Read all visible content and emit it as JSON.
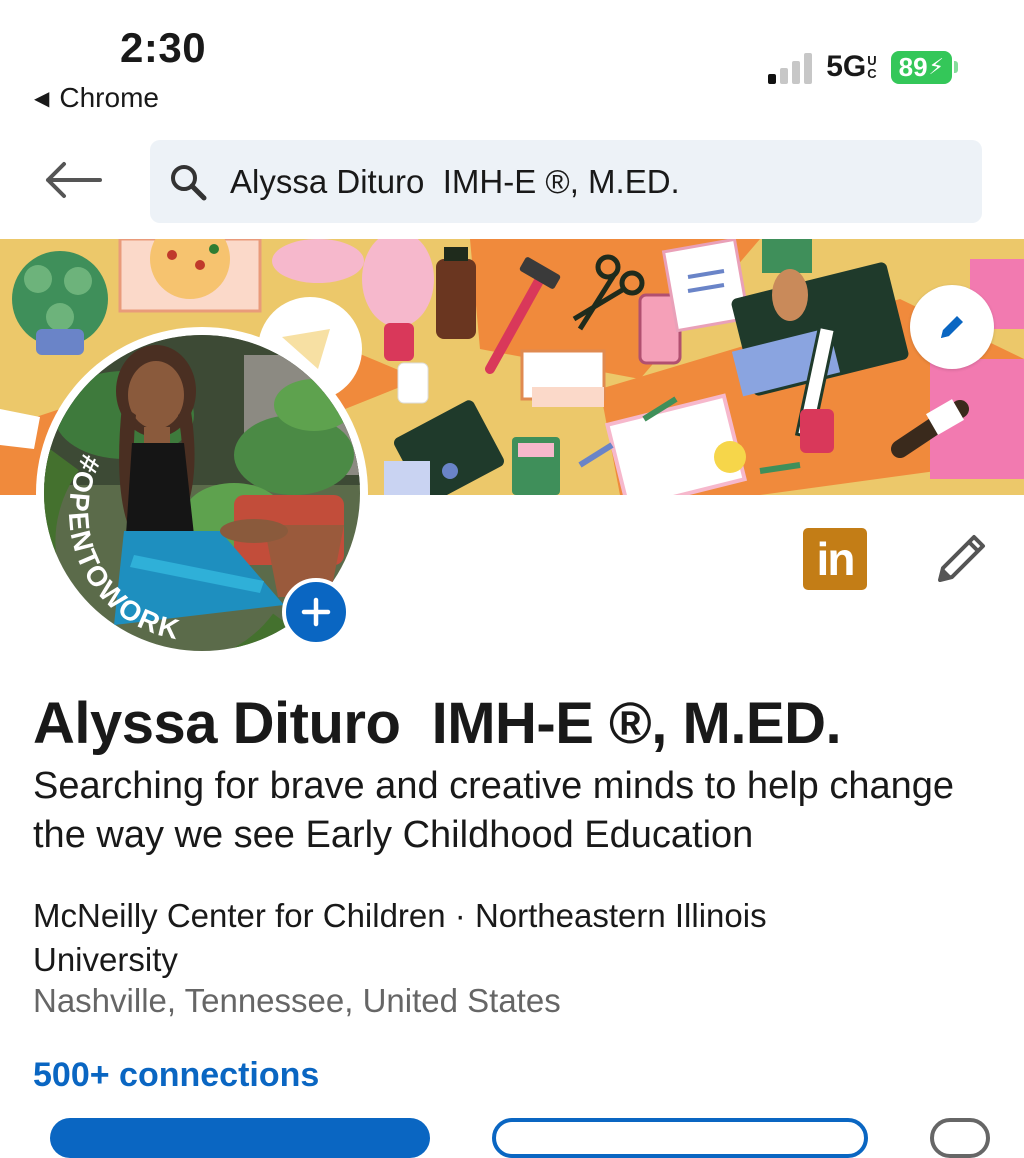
{
  "status_bar": {
    "time": "2:30",
    "back_app": "Chrome",
    "network": "5G",
    "network_sup": "U",
    "network_sub": "C",
    "battery": "89"
  },
  "search": {
    "value": "Alyssa Dituro  IMH-E ®, M.ED."
  },
  "profile": {
    "badge_text": "#OPENTOWORK",
    "name": "Alyssa Dituro  IMH-E ®, M.ED.",
    "headline": "Searching for brave and creative minds to help change the way we see Early Childhood Education",
    "company": "McNeilly Center for Children · Northeastern Illinois University",
    "location": "Nashville, Tennessee, United States",
    "connections": "500+ connections",
    "linkedin_badge": "in"
  },
  "colors": {
    "accent": "#0a66c2",
    "open_to_work_green": "#44712e",
    "linkedin_gold": "#c37d16",
    "banner_yellow": "#ecc86a",
    "battery_green": "#34c759"
  },
  "icons": {
    "back": "arrow-left-icon",
    "search": "search-icon",
    "edit_banner": "pencil-icon",
    "add_photo": "plus-icon",
    "edit_profile": "pencil-icon"
  }
}
